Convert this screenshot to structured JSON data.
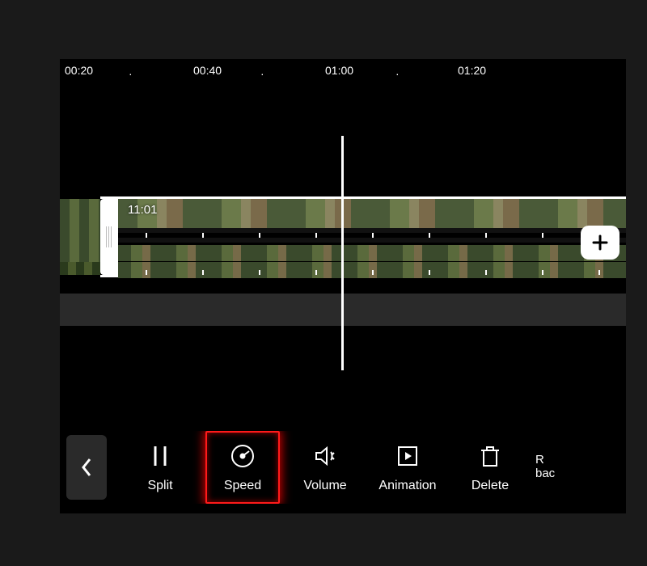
{
  "ruler": {
    "ticks": [
      "00:20",
      "00:40",
      "01:00",
      "01:20"
    ],
    "dot": "·"
  },
  "clip": {
    "duration": "11:01"
  },
  "add_button_label": "+",
  "back_label": "Back",
  "toolbar": {
    "split": "Split",
    "speed": "Speed",
    "volume": "Volume",
    "animation": "Animation",
    "delete": "Delete",
    "remove_bg_partial": "R\nbac"
  }
}
